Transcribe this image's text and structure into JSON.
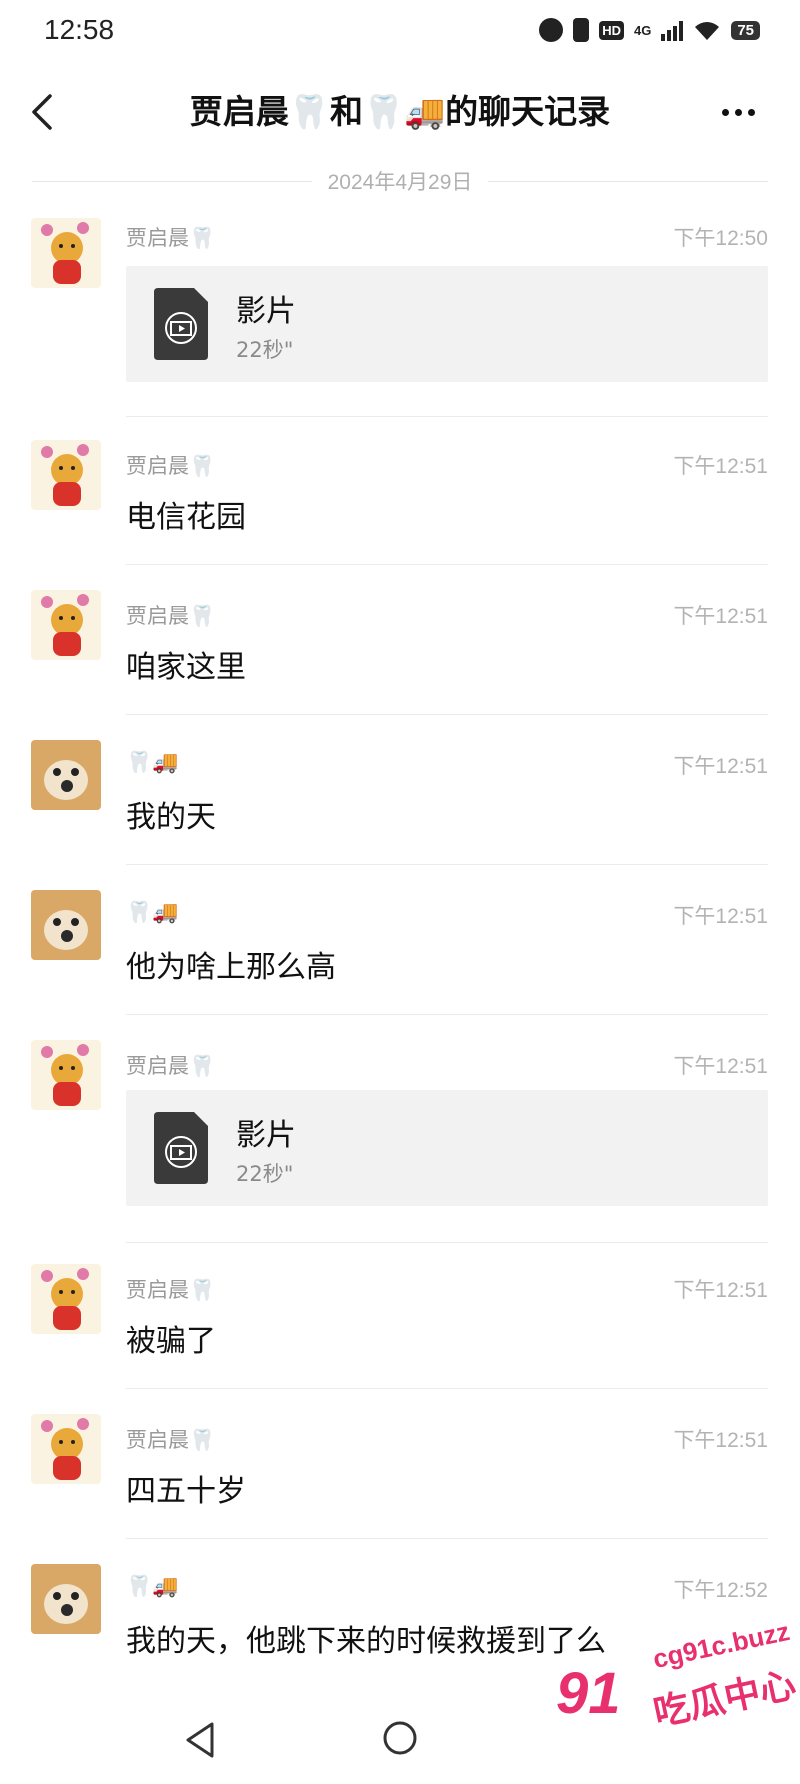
{
  "status_bar": {
    "time": "12:58",
    "network": "4G",
    "hd": "HD",
    "battery": "75"
  },
  "header": {
    "title": "贾启晨🦷和🦷🚚的聊天记录"
  },
  "date_divider": "2024年4月29日",
  "messages": [
    {
      "sender": "贾启晨🦷",
      "time": "下午12:50",
      "type": "video",
      "video_title": "影片",
      "video_duration": "22秒\""
    },
    {
      "sender": "贾启晨🦷",
      "time": "下午12:51",
      "type": "text",
      "text": "电信花园"
    },
    {
      "sender": "贾启晨🦷",
      "time": "下午12:51",
      "type": "text",
      "text": "咱家这里"
    },
    {
      "sender": "🦷🚚",
      "time": "下午12:51",
      "type": "text",
      "text": "我的天"
    },
    {
      "sender": "🦷🚚",
      "time": "下午12:51",
      "type": "text",
      "text": "他为啥上那么高"
    },
    {
      "sender": "贾启晨🦷",
      "time": "下午12:51",
      "type": "video",
      "video_title": "影片",
      "video_duration": "22秒\""
    },
    {
      "sender": "贾启晨🦷",
      "time": "下午12:51",
      "type": "text",
      "text": "被骗了"
    },
    {
      "sender": "贾启晨🦷",
      "time": "下午12:51",
      "type": "text",
      "text": "四五十岁"
    },
    {
      "sender": "🦷🚚",
      "time": "下午12:52",
      "type": "text",
      "text": "我的天，他跳下来的时候救援到了么"
    }
  ],
  "watermark": {
    "url": "cg91c.buzz",
    "logo": "91",
    "name": "吃瓜中心"
  },
  "colors": {
    "accent": "#e8306e",
    "timestamp": "#b3b3b3",
    "video_card_bg": "#f2f2f2"
  }
}
